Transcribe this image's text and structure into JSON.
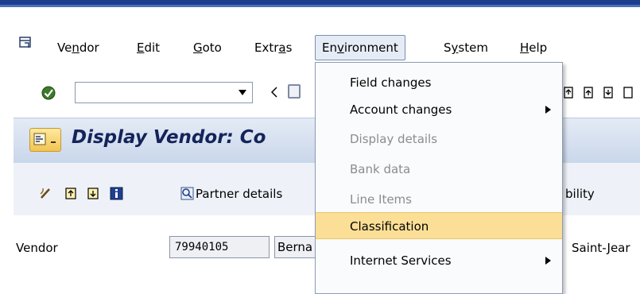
{
  "menubar": {
    "items": [
      {
        "label": "Vendor",
        "mnemonic_index": 2
      },
      {
        "label": "Edit",
        "mnemonic_index": 0
      },
      {
        "label": "Goto",
        "mnemonic_index": 0
      },
      {
        "label": "Extras",
        "mnemonic_index": 4
      },
      {
        "label": "Environment",
        "mnemonic_index": 2
      },
      {
        "label": "System",
        "mnemonic_index": 1
      },
      {
        "label": "Help",
        "mnemonic_index": 0
      }
    ]
  },
  "toolbar": {
    "command_field_value": ""
  },
  "title": {
    "text": "Display Vendor: Co"
  },
  "app_toolbar": {
    "partner_details": "Partner details",
    "truncated_right": "bility"
  },
  "vendor_row": {
    "label": "Vendor",
    "vendor_number": "79940105",
    "vendor_name": "Berna",
    "city": "Saint-Jear"
  },
  "dropdown": {
    "items": [
      {
        "label": "Field changes",
        "enabled": true,
        "submenu": false
      },
      {
        "label": "Account changes",
        "enabled": true,
        "submenu": true
      },
      {
        "label": "Display details",
        "enabled": false,
        "submenu": false
      },
      {
        "label": "Bank data",
        "enabled": false,
        "submenu": false
      },
      {
        "label": "Line Items",
        "enabled": false,
        "submenu": false
      },
      {
        "label": "Classification",
        "enabled": true,
        "submenu": false,
        "highlighted": true
      },
      {
        "label": "Internet Services",
        "enabled": true,
        "submenu": true
      }
    ]
  },
  "colors": {
    "title_text": "#14245a",
    "highlight": "#fbdf96",
    "top_bar": "#1d3e8f"
  }
}
